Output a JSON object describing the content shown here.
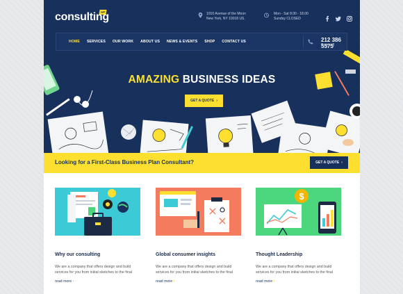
{
  "brand": {
    "logo": "consulting",
    "badge": "WP"
  },
  "contact": {
    "address_line1": "1010 Avenue of the Moon",
    "address_line2": "New York, NY 10018 US.",
    "hours_line1": "Mon - Sat 8.00 - 18.00",
    "hours_line2": "Sunday CLOSED",
    "phone": "212 386 5575",
    "phone_sub": "Free call"
  },
  "nav": {
    "items": [
      {
        "label": "HOME",
        "active": true
      },
      {
        "label": "SERVICES"
      },
      {
        "label": "OUR WORK"
      },
      {
        "label": "ABOUT US"
      },
      {
        "label": "NEWS & EVENTS"
      },
      {
        "label": "SHOP"
      },
      {
        "label": "CONTACT US"
      }
    ]
  },
  "social": [
    "facebook-icon",
    "twitter-icon",
    "instagram-icon"
  ],
  "hero": {
    "title_highlight": "AMAZING",
    "title_rest": " BUSINESS IDEAS",
    "button": "GET A QUOTE",
    "button_arrow": "›"
  },
  "banner": {
    "text": "Looking for a First-Class Business Plan Consultant?",
    "button": "GET A QUOTE",
    "button_arrow": "›"
  },
  "cards": [
    {
      "title": "Why our consulting",
      "text": "We are a company that offers design and build services for you from initial sketches to the final",
      "link": "read more",
      "link_arrow": "›",
      "bg": "#3ccbd6"
    },
    {
      "title": "Global consumer insights",
      "text": "We are a company that offers design and build services for you from initial sketches to the final",
      "link": "read more",
      "link_arrow": "›",
      "bg": "#f47b5e"
    },
    {
      "title": "Thought Leadership",
      "text": "We are a company that offers design and build services for you from initial sketches to the final",
      "link": "read more",
      "link_arrow": "›",
      "bg": "#4cd67e"
    }
  ],
  "colors": {
    "navy": "#17305c",
    "yellow": "#fde02f"
  }
}
